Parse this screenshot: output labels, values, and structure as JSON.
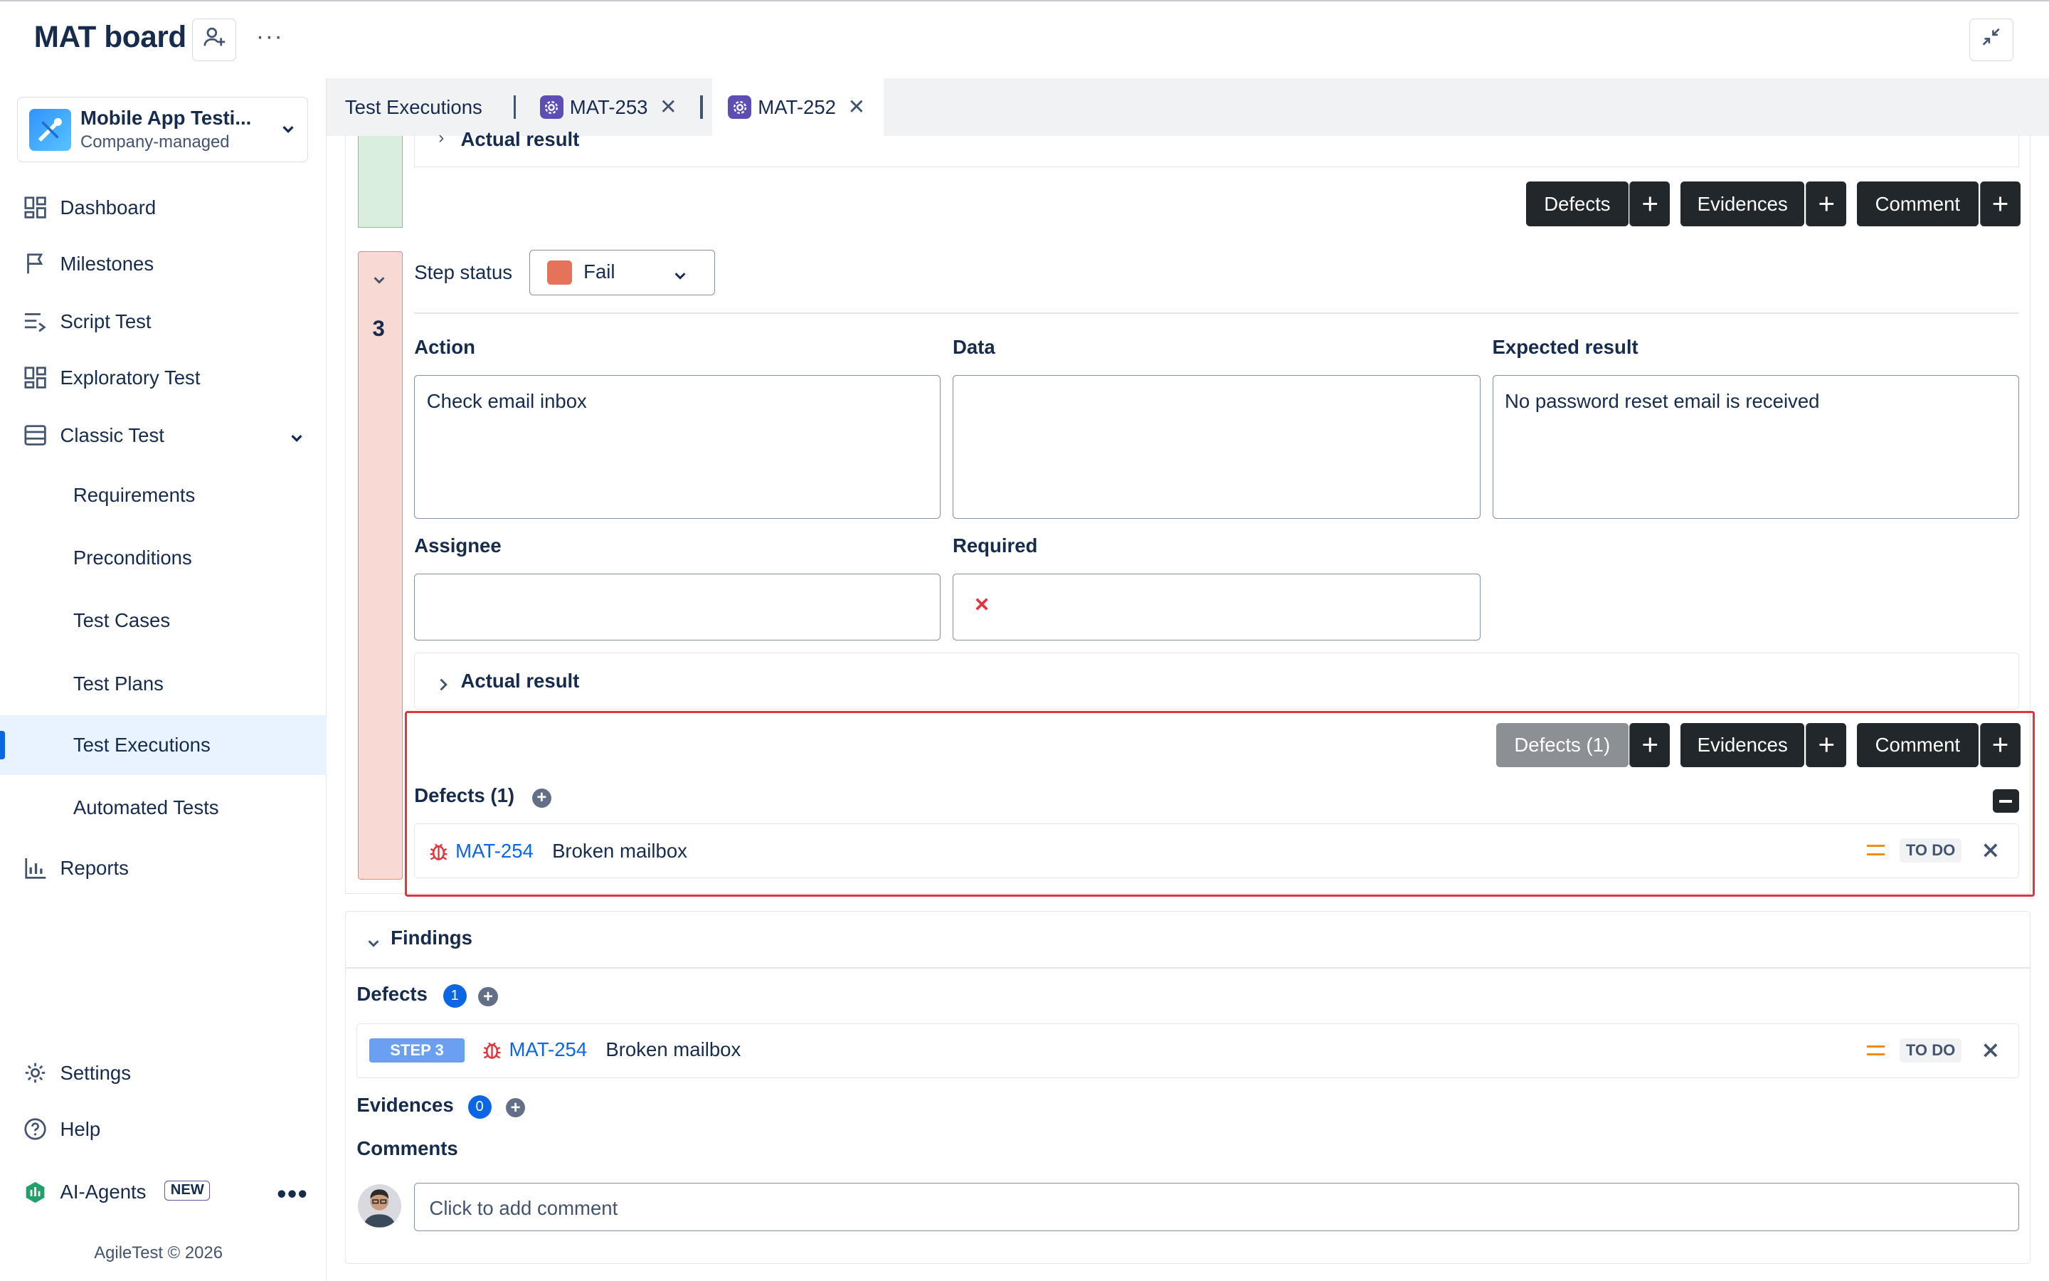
{
  "header": {
    "board_title": "MAT board",
    "more": "···"
  },
  "sidebar": {
    "project": {
      "name": "Mobile App Testi...",
      "type": "Company-managed"
    },
    "items": [
      {
        "label": "Dashboard"
      },
      {
        "label": "Milestones"
      },
      {
        "label": "Script Test"
      },
      {
        "label": "Exploratory Test"
      },
      {
        "label": "Classic Test"
      }
    ],
    "classic_sub": [
      {
        "label": "Requirements"
      },
      {
        "label": "Preconditions"
      },
      {
        "label": "Test Cases"
      },
      {
        "label": "Test Plans"
      },
      {
        "label": "Test Executions"
      },
      {
        "label": "Automated Tests"
      }
    ],
    "reports": "Reports",
    "settings": "Settings",
    "help": "Help",
    "ai_agents": "AI-Agents",
    "new_badge": "NEW",
    "footer": "AgileTest © 2026"
  },
  "tabs": [
    {
      "label": "Test Executions"
    },
    {
      "label": "MAT-253"
    },
    {
      "label": "MAT-252"
    }
  ],
  "step_prev": {
    "actual_result": "Actual result",
    "buttons": {
      "defects": "Defects",
      "evidences": "Evidences",
      "comment": "Comment"
    }
  },
  "step3": {
    "number": "3",
    "status_label": "Step status",
    "status_value": "Fail",
    "status_color": "#e5735a",
    "action_label": "Action",
    "action_value": "Check email inbox",
    "data_label": "Data",
    "data_value": "",
    "expected_label": "Expected result",
    "expected_value": "No password reset email is received",
    "assignee_label": "Assignee",
    "assignee_value": "",
    "required_label": "Required",
    "actual_result": "Actual result",
    "buttons": {
      "defects": "Defects (1)",
      "evidences": "Evidences",
      "comment": "Comment"
    },
    "defects_title": "Defects (1)",
    "defect": {
      "key": "MAT-254",
      "summary": "Broken mailbox",
      "status": "TO DO"
    }
  },
  "findings": {
    "title": "Findings",
    "defects_label": "Defects",
    "defects_count": "1",
    "defect": {
      "step": "STEP 3",
      "key": "MAT-254",
      "summary": "Broken mailbox",
      "status": "TO DO"
    },
    "evidences_label": "Evidences",
    "evidences_count": "0",
    "comments_label": "Comments",
    "comment_placeholder": "Click to add comment"
  },
  "colors": {
    "accent": "#0c66e4",
    "highlight_border": "#e2363f",
    "fail_bar": "#f8d9d3",
    "pass_bar": "#d9eedd"
  }
}
